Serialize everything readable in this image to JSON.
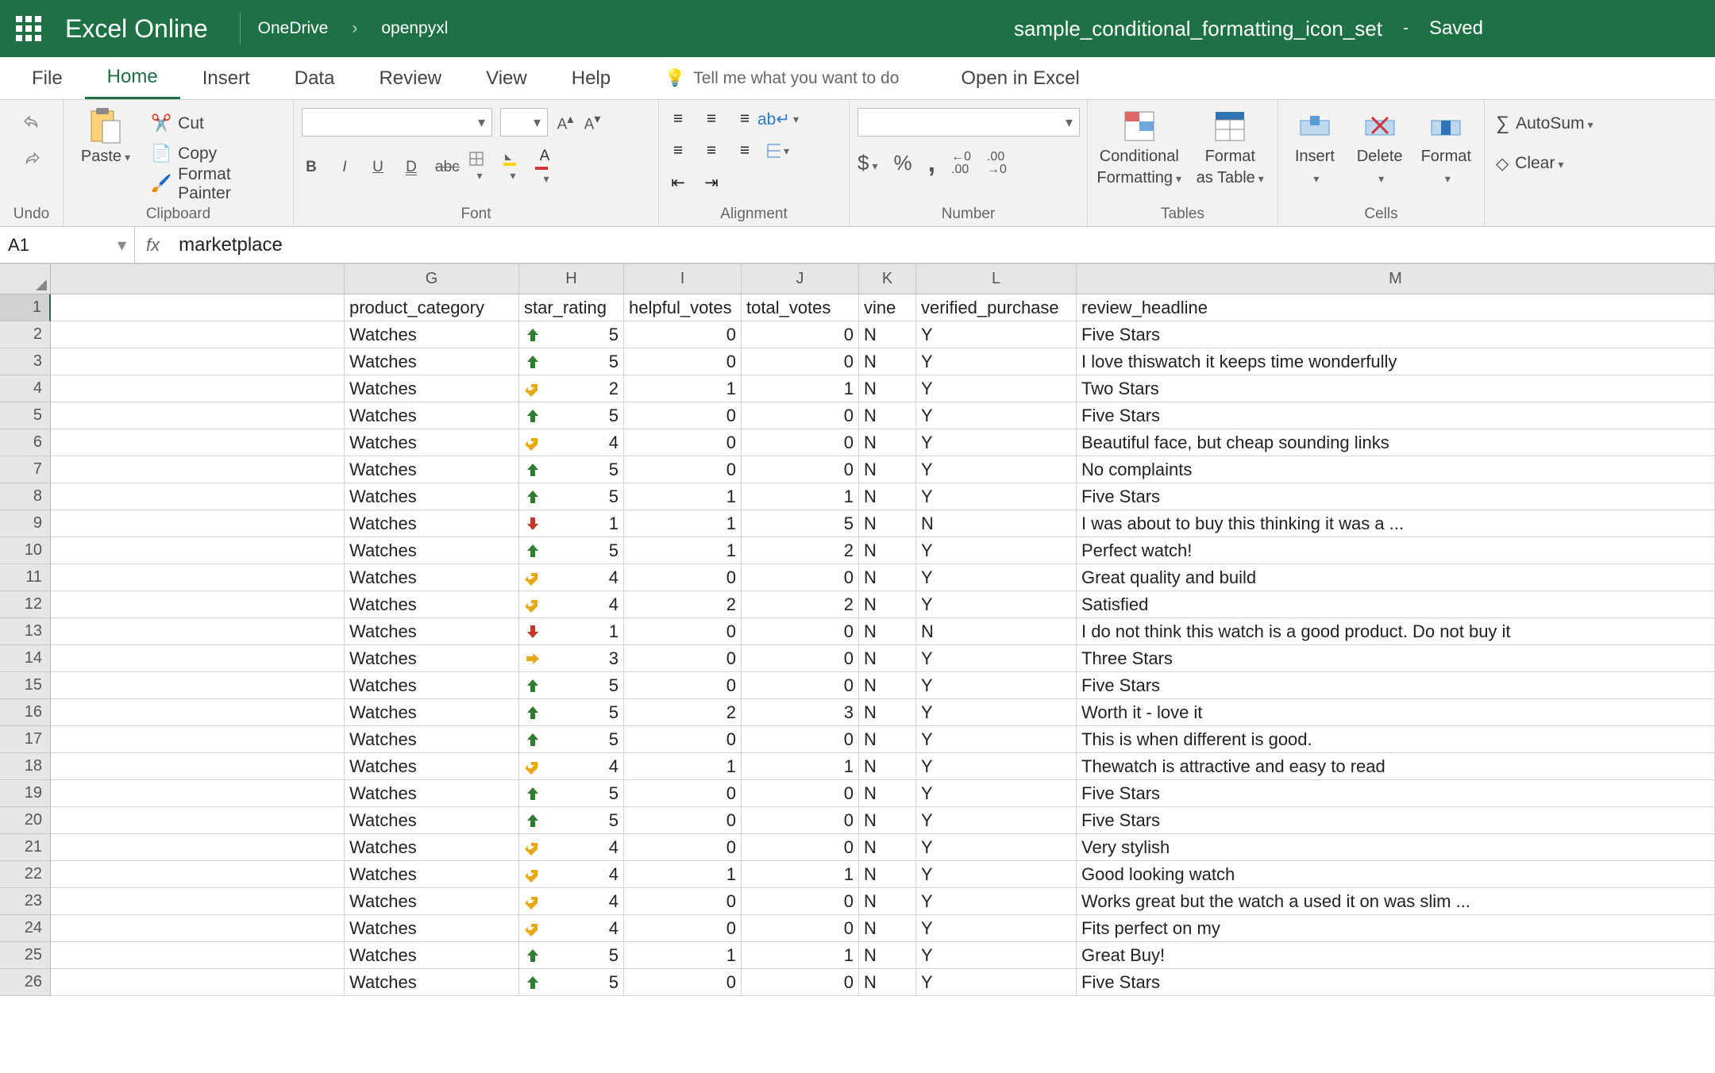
{
  "titlebar": {
    "app_name": "Excel Online",
    "breadcrumb1": "OneDrive",
    "breadcrumb2": "openpyxl",
    "doc_title": "sample_conditional_formatting_icon_set",
    "dash": "-",
    "saved": "Saved"
  },
  "tabs": {
    "file": "File",
    "home": "Home",
    "insert": "Insert",
    "data": "Data",
    "review": "Review",
    "view": "View",
    "help": "Help",
    "tell_me": "Tell me what you want to do",
    "open_in": "Open in Excel"
  },
  "ribbon": {
    "undo_label": "Undo",
    "cut": "Cut",
    "copy": "Copy",
    "format_painter": "Format Painter",
    "paste": "Paste",
    "clipboard_label": "Clipboard",
    "font_label": "Font",
    "alignment_label": "Alignment",
    "number_label": "Number",
    "tables_label": "Tables",
    "cells_label": "Cells",
    "cond_fmt": "Conditional",
    "cond_fmt2": "Formatting",
    "fmt_table": "Format",
    "fmt_table2": "as Table",
    "insert": "Insert",
    "delete": "Delete",
    "format": "Format",
    "autosum": "AutoSum",
    "clear": "Clear",
    "dollar": "$",
    "percent": "%",
    "comma": ",",
    "dec_inc": ".00",
    "dec_dec": ".00",
    "bold": "B",
    "italic": "I",
    "underline": "U",
    "dunder": "D",
    "strike": "abc"
  },
  "namebox": {
    "ref": "A1",
    "fx": "fx",
    "formula": "marketplace"
  },
  "columns": {
    "G": "G",
    "H": "H",
    "I": "I",
    "J": "J",
    "K": "K",
    "L": "L",
    "M": "M"
  },
  "headers": {
    "G": "product_category",
    "H": "star_rating",
    "I": "helpful_votes",
    "J": "total_votes",
    "K": "vine",
    "L": "verified_purchase",
    "M": "review_headline"
  },
  "rows": [
    {
      "n": 1
    },
    {
      "n": 2,
      "G": "Watches",
      "H": 5,
      "icon": "up",
      "I": 0,
      "J": 0,
      "K": "N",
      "L": "Y",
      "M": "Five Stars"
    },
    {
      "n": 3,
      "G": "Watches",
      "H": 5,
      "icon": "up",
      "I": 0,
      "J": 0,
      "K": "N",
      "L": "Y",
      "M": "I love thiswatch it keeps time wonderfully"
    },
    {
      "n": 4,
      "G": "Watches",
      "H": 2,
      "icon": "diag",
      "I": 1,
      "J": 1,
      "K": "N",
      "L": "Y",
      "M": "Two Stars"
    },
    {
      "n": 5,
      "G": "Watches",
      "H": 5,
      "icon": "up",
      "I": 0,
      "J": 0,
      "K": "N",
      "L": "Y",
      "M": "Five Stars"
    },
    {
      "n": 6,
      "G": "Watches",
      "H": 4,
      "icon": "diag",
      "I": 0,
      "J": 0,
      "K": "N",
      "L": "Y",
      "M": "Beautiful face, but cheap sounding links"
    },
    {
      "n": 7,
      "G": "Watches",
      "H": 5,
      "icon": "up",
      "I": 0,
      "J": 0,
      "K": "N",
      "L": "Y",
      "M": "No complaints"
    },
    {
      "n": 8,
      "G": "Watches",
      "H": 5,
      "icon": "up",
      "I": 1,
      "J": 1,
      "K": "N",
      "L": "Y",
      "M": "Five Stars"
    },
    {
      "n": 9,
      "G": "Watches",
      "H": 1,
      "icon": "down",
      "I": 1,
      "J": 5,
      "K": "N",
      "L": "N",
      "M": "I was about to buy this thinking it was a ..."
    },
    {
      "n": 10,
      "G": "Watches",
      "H": 5,
      "icon": "up",
      "I": 1,
      "J": 2,
      "K": "N",
      "L": "Y",
      "M": "Perfect watch!"
    },
    {
      "n": 11,
      "G": "Watches",
      "H": 4,
      "icon": "diag",
      "I": 0,
      "J": 0,
      "K": "N",
      "L": "Y",
      "M": "Great quality and build"
    },
    {
      "n": 12,
      "G": "Watches",
      "H": 4,
      "icon": "diag",
      "I": 2,
      "J": 2,
      "K": "N",
      "L": "Y",
      "M": "Satisfied"
    },
    {
      "n": 13,
      "G": "Watches",
      "H": 1,
      "icon": "down",
      "I": 0,
      "J": 0,
      "K": "N",
      "L": "N",
      "M": "I do not think this watch is a good product. Do not buy it"
    },
    {
      "n": 14,
      "G": "Watches",
      "H": 3,
      "icon": "right",
      "I": 0,
      "J": 0,
      "K": "N",
      "L": "Y",
      "M": "Three Stars"
    },
    {
      "n": 15,
      "G": "Watches",
      "H": 5,
      "icon": "up",
      "I": 0,
      "J": 0,
      "K": "N",
      "L": "Y",
      "M": "Five Stars"
    },
    {
      "n": 16,
      "G": "Watches",
      "H": 5,
      "icon": "up",
      "I": 2,
      "J": 3,
      "K": "N",
      "L": "Y",
      "M": "Worth it - love it"
    },
    {
      "n": 17,
      "G": "Watches",
      "H": 5,
      "icon": "up",
      "I": 0,
      "J": 0,
      "K": "N",
      "L": "Y",
      "M": "This is when different is good."
    },
    {
      "n": 18,
      "G": "Watches",
      "H": 4,
      "icon": "diag",
      "I": 1,
      "J": 1,
      "K": "N",
      "L": "Y",
      "M": "Thewatch is attractive and easy to read"
    },
    {
      "n": 19,
      "G": "Watches",
      "H": 5,
      "icon": "up",
      "I": 0,
      "J": 0,
      "K": "N",
      "L": "Y",
      "M": "Five Stars"
    },
    {
      "n": 20,
      "G": "Watches",
      "H": 5,
      "icon": "up",
      "I": 0,
      "J": 0,
      "K": "N",
      "L": "Y",
      "M": "Five Stars"
    },
    {
      "n": 21,
      "G": "Watches",
      "H": 4,
      "icon": "diag",
      "I": 0,
      "J": 0,
      "K": "N",
      "L": "Y",
      "M": "Very stylish"
    },
    {
      "n": 22,
      "G": "Watches",
      "H": 4,
      "icon": "diag",
      "I": 1,
      "J": 1,
      "K": "N",
      "L": "Y",
      "M": "Good looking watch"
    },
    {
      "n": 23,
      "G": "Watches",
      "H": 4,
      "icon": "diag",
      "I": 0,
      "J": 0,
      "K": "N",
      "L": "Y",
      "M": "Works great but the watch a used it on was slim ..."
    },
    {
      "n": 24,
      "G": "Watches",
      "H": 4,
      "icon": "diag",
      "I": 0,
      "J": 0,
      "K": "N",
      "L": "Y",
      "M": "Fits perfect on my"
    },
    {
      "n": 25,
      "G": "Watches",
      "H": 5,
      "icon": "up",
      "I": 1,
      "J": 1,
      "K": "N",
      "L": "Y",
      "M": "Great Buy!"
    },
    {
      "n": 26,
      "G": "Watches",
      "H": 5,
      "icon": "up",
      "I": 0,
      "J": 0,
      "K": "N",
      "L": "Y",
      "M": "Five Stars"
    }
  ]
}
